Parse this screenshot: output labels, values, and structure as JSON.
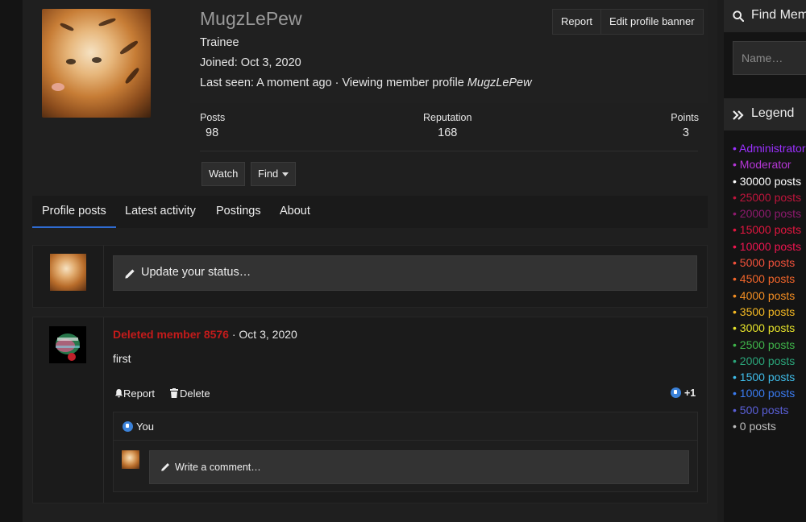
{
  "profile": {
    "username": "MugzLePew",
    "title": "Trainee",
    "joined": "Joined: Oct 3, 2020",
    "last_seen_prefix": "Last seen: A moment ago · Viewing member profile ",
    "last_seen_target": "MugzLePew",
    "buttons": {
      "report": "Report",
      "edit_banner": "Edit profile banner"
    },
    "stats": [
      {
        "label": "Posts",
        "value": "98"
      },
      {
        "label": "Reputation",
        "value": "168"
      },
      {
        "label": "Points",
        "value": "3"
      }
    ],
    "actions": {
      "watch": "Watch",
      "find": "Find"
    }
  },
  "tabs": [
    "Profile posts",
    "Latest activity",
    "Postings",
    "About"
  ],
  "active_tab": "Profile posts",
  "status_placeholder": "Update your status…",
  "post": {
    "author": "Deleted member 8576",
    "separator": " · ",
    "date": "Oct 3, 2020",
    "text": "first",
    "report": "Report",
    "delete": "Delete",
    "like_count": "+1",
    "liked_by": "You",
    "comment_placeholder": "Write a comment…"
  },
  "sidebar": {
    "find_members_title": "Find Members",
    "name_placeholder": "Name…",
    "legend_title": "Legend",
    "legend": [
      {
        "label": "• Administrator",
        "color": "#9b30ff"
      },
      {
        "label": "• Moderator",
        "color": "#b536d6"
      },
      {
        "label": "• 30000 posts",
        "color": "#ffffff"
      },
      {
        "label": "• 25000 posts",
        "color": "#c0143c"
      },
      {
        "label": "• 20000 posts",
        "color": "#8e1a6e"
      },
      {
        "label": "• 15000 posts",
        "color": "#e2163f"
      },
      {
        "label": "• 10000 posts",
        "color": "#ef1550"
      },
      {
        "label": "• 5000 posts",
        "color": "#f2513b"
      },
      {
        "label": "• 4500 posts",
        "color": "#f2652a"
      },
      {
        "label": "• 4000 posts",
        "color": "#f28d22"
      },
      {
        "label": "• 3500 posts",
        "color": "#f5b923"
      },
      {
        "label": "• 3000 posts",
        "color": "#e6e32a"
      },
      {
        "label": "• 2500 posts",
        "color": "#3fb54a"
      },
      {
        "label": "• 2000 posts",
        "color": "#2aa57a"
      },
      {
        "label": "• 1500 posts",
        "color": "#3fbdea"
      },
      {
        "label": "• 1000 posts",
        "color": "#3a7bf0"
      },
      {
        "label": "• 500 posts",
        "color": "#5a5fd8"
      },
      {
        "label": "• 0 posts",
        "color": "#bdbdbd"
      }
    ]
  },
  "colors": {
    "accent": "#2f6bd0",
    "deleted_member": "#c41b1b",
    "like": "#3b82d9"
  }
}
